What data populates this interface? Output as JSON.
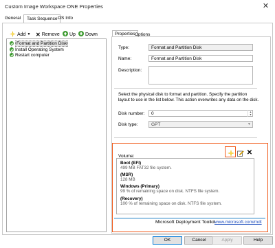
{
  "window": {
    "title": "Custom Image Workspace ONE Properties",
    "close_glyph": "✕"
  },
  "tabs": [
    {
      "label": "General"
    },
    {
      "label": "Task Sequence"
    },
    {
      "label": "OS Info"
    }
  ],
  "toolbar": {
    "add": "Add",
    "remove": "Remove",
    "up": "Up",
    "down": "Down"
  },
  "tree": {
    "items": [
      {
        "label": "Format and Partition Disk",
        "selected": true
      },
      {
        "label": "Install Operating System",
        "selected": false
      },
      {
        "label": "Restart computer",
        "selected": false
      }
    ]
  },
  "right_tabs": [
    {
      "label": "Properties"
    },
    {
      "label": "Options"
    }
  ],
  "properties": {
    "type_label": "Type:",
    "type_value": "Format and Partition Disk",
    "name_label": "Name:",
    "name_value": "Format and Partition Disk",
    "description_label": "Description:",
    "description_value": "",
    "help_text": "Select the physical disk to format and partition.  Specify the partition layout to use in the list below.  This action overwrites any data on the disk.",
    "disk_number_label": "Disk number:",
    "disk_number_value": "0",
    "disk_type_label": "Disk type:",
    "disk_type_value": "GPT",
    "volume_label": "Volume:"
  },
  "volumes": [
    {
      "name": "Boot (EFI)",
      "detail": "499 MB FAT32 file system."
    },
    {
      "name": "(MSR)",
      "detail": "128 MB"
    },
    {
      "name": "Windows (Primary)",
      "detail": "99 % of remaining space on disk. NTFS file system."
    },
    {
      "name": "(Recovery)",
      "detail": "100 % of remaining space on disk. NTFS file system."
    }
  ],
  "footer": {
    "product": "Microsoft Deployment Toolkit",
    "link": "www.microsoft.com/mdt"
  },
  "buttons": {
    "ok": "OK",
    "cancel": "Cancel",
    "apply": "Apply",
    "help": "Help"
  },
  "colors": {
    "highlight": "#f05a1a",
    "link": "#1a4bbd",
    "success": "#3b9a2e"
  }
}
